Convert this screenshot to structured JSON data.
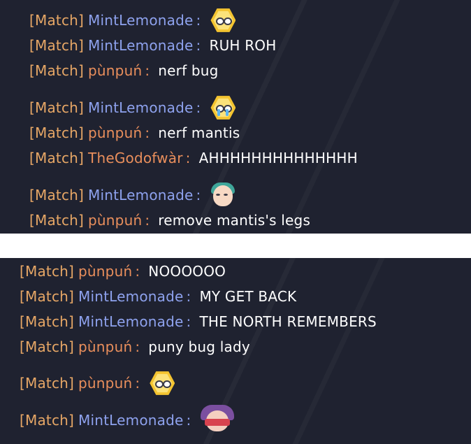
{
  "chat_top": [
    {
      "tag": "[Match]",
      "name": "MintLemonade",
      "name_color": "blue",
      "emote": "annoyed-bee-emote"
    },
    {
      "tag": "[Match]",
      "name": "MintLemonade",
      "name_color": "blue",
      "text": "RUH ROH"
    },
    {
      "tag": "[Match]",
      "name": "pùnpuń",
      "name_color": "orange",
      "text": "nerf bug"
    },
    {
      "tag": "[Match]",
      "name": "MintLemonade",
      "name_color": "blue",
      "emote": "crying-bee-emote"
    },
    {
      "tag": "[Match]",
      "name": "pùnpuń",
      "name_color": "orange",
      "text": "nerf mantis"
    },
    {
      "tag": "[Match]",
      "name": "TheGodofwàr",
      "name_color": "orange",
      "text": "AHHHHHHHHHHHHHH"
    },
    {
      "tag": "[Match]",
      "name": "MintLemonade",
      "name_color": "blue",
      "emote": "girl-sticker-emote"
    },
    {
      "tag": "[Match]",
      "name": "pùnpuń",
      "name_color": "orange",
      "text": "remove mantis's legs"
    }
  ],
  "chat_bottom": [
    {
      "tag": "[Match]",
      "name": "pùnpuń",
      "name_color": "orange",
      "text": "NOOOOOO"
    },
    {
      "tag": "[Match]",
      "name": "MintLemonade",
      "name_color": "blue",
      "text": "MY GET BACK"
    },
    {
      "tag": "[Match]",
      "name": "MintLemonade",
      "name_color": "blue",
      "text": "THE NORTH REMEMBERS"
    },
    {
      "tag": "[Match]",
      "name": "pùnpuń",
      "name_color": "orange",
      "text": "puny bug lady"
    },
    {
      "tag": "[Match]",
      "name": "pùnpuń",
      "name_color": "orange",
      "emote": "annoyed-bee-emote"
    },
    {
      "tag": "[Match]",
      "name": "MintLemonade",
      "name_color": "blue",
      "emote": "masked-hero-emote"
    }
  ],
  "colon": ":",
  "colors": {
    "tag": "#e7a766",
    "name_blue": "#8ea2ee",
    "name_orange": "#ea8f5c",
    "message": "#ffffff",
    "panel_bg": "#1f2230"
  }
}
